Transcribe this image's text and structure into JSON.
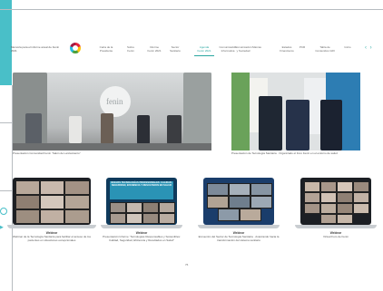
{
  "header": {
    "brand": "Memoria para el informe anual de Fenin 2021",
    "nav": [
      {
        "label": "Carta de la\nPresidente"
      },
      {
        "label": "Sobre\nFenin"
      },
      {
        "label": "Informe\nFenin 2021"
      },
      {
        "label": "Sector\nSanitario"
      },
      {
        "label": "Agenda\nFenin 2021"
      },
      {
        "label": "Comunicación\nInformativa"
      },
      {
        "label": "Comunicación\ny Sociedad"
      },
      {
        "label": "Marcas"
      },
      {
        "label": "Estados\nFinancieros"
      },
      {
        "label": "PCR"
      },
      {
        "label": "Tabla de\nContenidos GRI"
      },
      {
        "label": "Inicio"
      }
    ],
    "active_nav_index": 5,
    "arrows": "‹ ›"
  },
  "photos": [
    {
      "caption": "Presentación Comunidad Fenin “Salón de Lanzamiento”",
      "alt_text": "fenin"
    },
    {
      "caption": "Presentación de Tecnología Sanitaria · Organizado el Foro Fenin en el entorno de salud"
    }
  ],
  "laptops": [
    {
      "title": "Webinar",
      "caption": "Webinar de la Tecnología Sanitaria para facilitar el acceso de los pacientes en situaciones excepcionales"
    },
    {
      "title": "Webinar",
      "caption": "Presentación Informe “Tecnologías Responsables y Sostenibles: Calidad, Seguridad, Eficiencia y Resultados en Salud”",
      "screen_text": "NUEVAS TECNOLOGÍAS PROFESIONALES: CALIDAD, SEGURIDAD, EFICIENCIA Y RESULTADOS EN SALUD"
    },
    {
      "title": "Webinar",
      "caption": "Encuentro del Sector de Tecnología Sanitaria · Avanzando hacia la transformación del sistema sanitario"
    },
    {
      "title": "Webinar",
      "caption": "Virtual Foro de Fenin"
    }
  ],
  "page_number": "76",
  "colors": {
    "accent": "#49bfc8",
    "nav_active": "#2aa7a1"
  }
}
